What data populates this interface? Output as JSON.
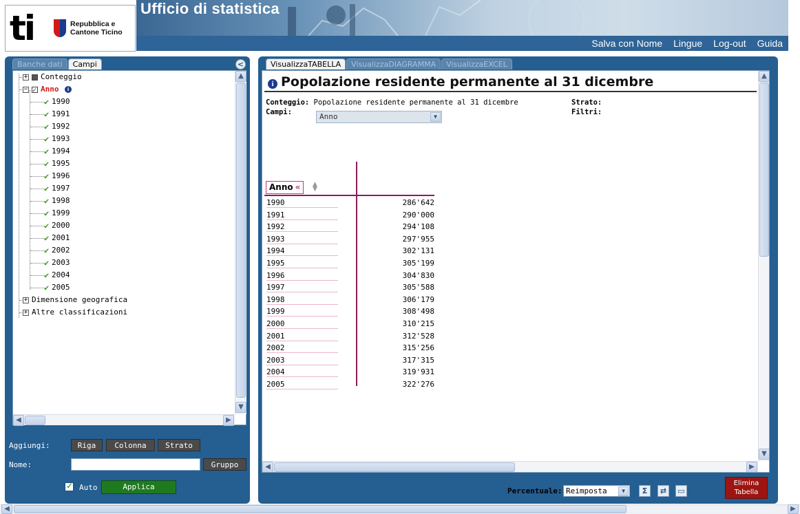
{
  "header": {
    "logo_ti": "ti",
    "logo_line1": "Repubblica e",
    "logo_line2": "Cantone Ticino",
    "title": "Ufficio di statistica",
    "nav": [
      "Salva con Nome",
      "Lingue",
      "Log-out",
      "Guida"
    ]
  },
  "left": {
    "tabs": [
      {
        "label": "Banche dati",
        "active": false
      },
      {
        "label": "Campi",
        "active": true
      }
    ],
    "tree": {
      "conteggio": "Conteggio",
      "anno": "Anno",
      "years": [
        "1990",
        "1991",
        "1992",
        "1993",
        "1994",
        "1995",
        "1996",
        "1997",
        "1998",
        "1999",
        "2000",
        "2001",
        "2002",
        "2003",
        "2004",
        "2005"
      ],
      "dimensione": "Dimensione geografica",
      "altre": "Altre classificazioni"
    },
    "aggiungi_label": "Aggiungi:",
    "buttons": {
      "riga": "Riga",
      "colonna": "Colonna",
      "strato": "Strato"
    },
    "nome_label": "Nome:",
    "nome_value": "",
    "gruppo": "Gruppo",
    "auto_label": "Auto",
    "auto_checked": true,
    "applica": "Applica"
  },
  "right": {
    "tabs": [
      {
        "label": "VisualizzaTABELLA",
        "active": true
      },
      {
        "label": "VisualizzaDIAGRAMMA",
        "active": false
      },
      {
        "label": "VisualizzaEXCEL",
        "active": false
      }
    ],
    "title": "Popolazione residente permanente al 31 dicembre",
    "conteggio_label": "Conteggio:",
    "conteggio_value": "Popolazione residente permanente al 31 dicembre",
    "campi_label": "Campi:",
    "campi_value": "Anno",
    "strato_label": "Strato:",
    "filtri_label": "Filtri:",
    "table_header": "Anno",
    "table_header_arrow": "«",
    "rows": [
      {
        "year": "1990",
        "value": "286'642"
      },
      {
        "year": "1991",
        "value": "290'000"
      },
      {
        "year": "1992",
        "value": "294'108"
      },
      {
        "year": "1993",
        "value": "297'955"
      },
      {
        "year": "1994",
        "value": "302'131"
      },
      {
        "year": "1995",
        "value": "305'199"
      },
      {
        "year": "1996",
        "value": "304'830"
      },
      {
        "year": "1997",
        "value": "305'588"
      },
      {
        "year": "1998",
        "value": "306'179"
      },
      {
        "year": "1999",
        "value": "308'498"
      },
      {
        "year": "2000",
        "value": "310'215"
      },
      {
        "year": "2001",
        "value": "312'528"
      },
      {
        "year": "2002",
        "value": "315'256"
      },
      {
        "year": "2003",
        "value": "317'315"
      },
      {
        "year": "2004",
        "value": "319'931"
      },
      {
        "year": "2005",
        "value": "322'276"
      }
    ],
    "percentuale_label": "Percentuale:",
    "percentuale_value": "Reimposta",
    "elimina_line1": "Elimina",
    "elimina_line2": "Tabella"
  },
  "colors": {
    "panel": "#255e90",
    "accent_table": "#8b1a5c",
    "apply_green": "#1f7a1f",
    "delete_red": "#9c1512"
  }
}
